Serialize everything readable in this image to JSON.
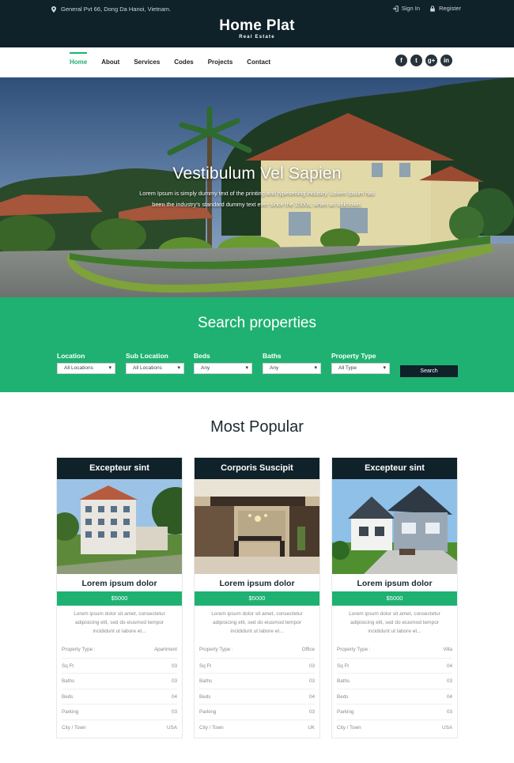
{
  "header": {
    "address": "General Pvt 66, Dong Da Hanoi, Vietnam.",
    "brand_title": "Home Plat",
    "brand_sub": "Real Estate",
    "sign_in": "Sign In",
    "register": "Register"
  },
  "nav": {
    "items": [
      "Home",
      "About",
      "Services",
      "Codes",
      "Projects",
      "Contact"
    ],
    "active": "Home"
  },
  "social": [
    "facebook-icon",
    "twitter-icon",
    "google-plus-icon",
    "linkedin-icon"
  ],
  "hero": {
    "title": "Vestibulum Vel Sapien",
    "text": "Lorem Ipsum is simply dummy text of the printing and typesetting industry. Lorem Ipsum has been the industry's standard dummy text ever since the 1500s, when an unknown."
  },
  "search": {
    "title": "Search properties",
    "fields": [
      {
        "label": "Location",
        "value": "All Locations"
      },
      {
        "label": "Sub Location",
        "value": "All Locations"
      },
      {
        "label": "Beds",
        "value": "Any"
      },
      {
        "label": "Baths",
        "value": "Any"
      },
      {
        "label": "Property Type",
        "value": "All Type"
      }
    ],
    "button": "Search"
  },
  "popular": {
    "title": "Most Popular",
    "cards": [
      {
        "head": "Excepteur sint",
        "name": "Lorem ipsum dolor",
        "price": "$5000",
        "desc": "Lorem ipsum dolor sit amet, consectetur adipisicing elit, sed do eiusmod tempor incididunt ut labore et...",
        "rows": [
          [
            "Property Type :",
            "Apartment"
          ],
          [
            "Sq Ft",
            "03"
          ],
          [
            "Baths",
            "03"
          ],
          [
            "Beds",
            "04"
          ],
          [
            "Parking",
            "03"
          ],
          [
            "City / Town",
            "USA"
          ]
        ]
      },
      {
        "head": "Corporis Suscipit",
        "name": "Lorem ipsum dolor",
        "price": "$5000",
        "desc": "Lorem ipsum dolor sit amet, consectetur adipisicing elit, sed do eiusmod tempor incididunt ut labore et...",
        "rows": [
          [
            "Property Type :",
            "Office"
          ],
          [
            "Sq Ft",
            "03"
          ],
          [
            "Baths",
            "03"
          ],
          [
            "Beds",
            "04"
          ],
          [
            "Parking",
            "03"
          ],
          [
            "City / Town",
            "UK"
          ]
        ]
      },
      {
        "head": "Excepteur sint",
        "name": "Lorem ipsum dolor",
        "price": "$5000",
        "desc": "Lorem ipsum dolor sit amet, consectetur adipisicing elit, sed do eiusmod tempor incididunt ut labore et...",
        "rows": [
          [
            "Property Type :",
            "Villa"
          ],
          [
            "Sq Ft",
            "04"
          ],
          [
            "Baths",
            "03"
          ],
          [
            "Beds",
            "04"
          ],
          [
            "Parking",
            "03"
          ],
          [
            "City / Town",
            "USA"
          ]
        ]
      }
    ]
  },
  "colors": {
    "dark": "#0f2129",
    "accent": "#1fb172"
  }
}
